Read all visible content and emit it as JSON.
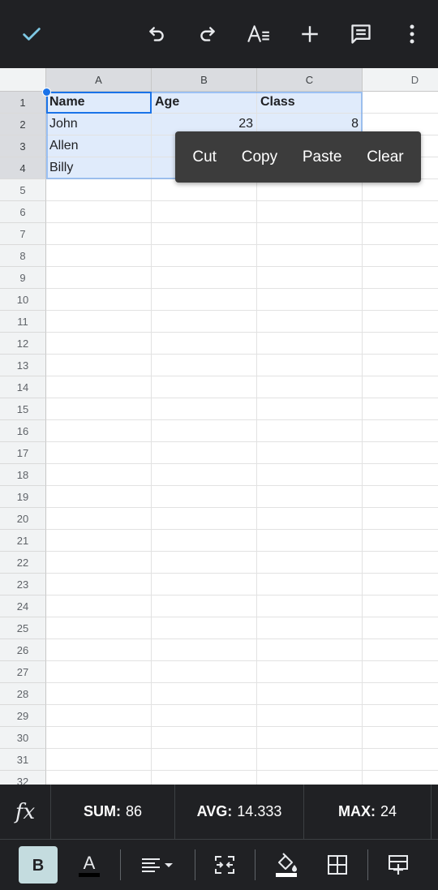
{
  "columns": [
    "A",
    "B",
    "C",
    "D"
  ],
  "rows": [
    "1",
    "2",
    "3",
    "4",
    "5",
    "6",
    "7",
    "8",
    "9",
    "10",
    "11",
    "12",
    "13",
    "14",
    "15",
    "16",
    "17",
    "18",
    "19",
    "20",
    "21",
    "22",
    "23",
    "24",
    "25",
    "26",
    "27",
    "28",
    "29",
    "30",
    "31",
    "32"
  ],
  "cells": {
    "A1": "Name",
    "B1": "Age",
    "C1": "Class",
    "A2": "John",
    "B2": "23",
    "C2": "8",
    "A3": "Allen",
    "A4": "Billy"
  },
  "context_menu": {
    "cut": "Cut",
    "copy": "Copy",
    "paste": "Paste",
    "clear": "Clear"
  },
  "status": {
    "fx": "fx",
    "sum_label": "SUM:",
    "sum_value": "86",
    "avg_label": "AVG:",
    "avg_value": "14.333",
    "max_label": "MAX:",
    "max_value": "24"
  },
  "icons": {
    "top": [
      "check-icon",
      "undo-icon",
      "redo-icon",
      "text-format-icon",
      "add-icon",
      "comment-icon",
      "more-vert-icon"
    ],
    "bottom": [
      "bold-icon",
      "text-color-icon",
      "align-icon",
      "merge-cells-icon",
      "fill-color-icon",
      "borders-icon",
      "insert-row-icon"
    ]
  },
  "colors": {
    "accent": "#1a73e8",
    "check": "#7ec8e3",
    "toolbar": "#202124",
    "selection": "#e0ebfb"
  }
}
